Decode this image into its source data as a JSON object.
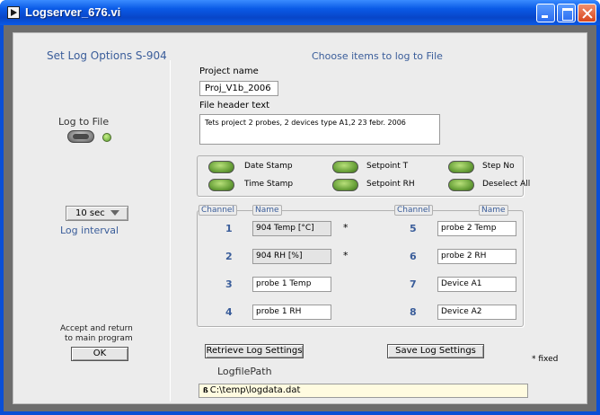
{
  "window": {
    "title": "Logserver_676.vi"
  },
  "left": {
    "set_options_title": "Set Log Options S-904",
    "log_to_file_label": "Log to File",
    "interval_value": "10 sec",
    "interval_label": "Log interval",
    "accept_label_line1": "Accept and return",
    "accept_label_line2": "to main program",
    "ok_label": "OK"
  },
  "main": {
    "choose_title": "Choose items to log to File",
    "project_name_label": "Project name",
    "project_name_value": "Proj_V1b_2006",
    "file_header_label": "File header text",
    "file_header_value": "Tets project 2 probes, 2 devices type A1,2 23 febr. 2006",
    "options": [
      {
        "label": "Date Stamp"
      },
      {
        "label": "Time Stamp"
      },
      {
        "label": "Setpoint T"
      },
      {
        "label": "Setpoint RH"
      },
      {
        "label": "Step No"
      },
      {
        "label": "Deselect All"
      }
    ],
    "channel_header": "Channel",
    "name_header": "Name",
    "channels_left": [
      {
        "num": "1",
        "name": "904 Temp [°C]",
        "fixed": true
      },
      {
        "num": "2",
        "name": "904 RH [%]",
        "fixed": true
      },
      {
        "num": "3",
        "name": "probe 1 Temp",
        "fixed": false
      },
      {
        "num": "4",
        "name": "probe 1 RH",
        "fixed": false
      }
    ],
    "channels_right": [
      {
        "num": "5",
        "name": "probe 2 Temp"
      },
      {
        "num": "6",
        "name": "probe 2 RH"
      },
      {
        "num": "7",
        "name": "Device A1"
      },
      {
        "num": "8",
        "name": "Device A2"
      }
    ],
    "star": "*",
    "fixed_note": "* fixed",
    "retrieve_button": "Retrieve Log Settings",
    "save_button": "Save Log Settings",
    "logfile_path_label": "LogfilePath",
    "logfile_path_value": "C:\\temp\\logdata.dat"
  }
}
